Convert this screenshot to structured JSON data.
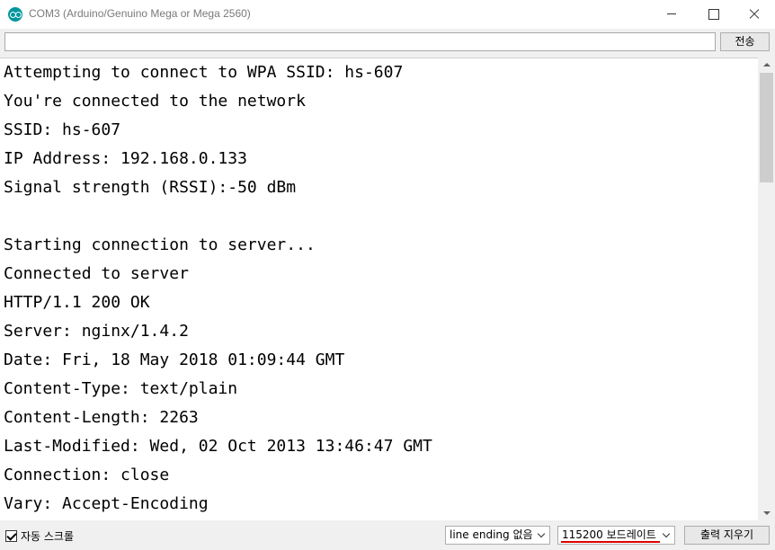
{
  "window": {
    "title": "COM3 (Arduino/Genuino Mega or Mega 2560)"
  },
  "send_bar": {
    "input_value": "",
    "send_label": "전송"
  },
  "output": {
    "lines": [
      "Attempting to connect to WPA SSID: hs-607",
      "You're connected to the network",
      "SSID: hs-607",
      "IP Address: 192.168.0.133",
      "Signal strength (RSSI):-50 dBm",
      "",
      "Starting connection to server...",
      "Connected to server",
      "HTTP/1.1 200 OK",
      "Server: nginx/1.4.2",
      "Date: Fri, 18 May 2018 01:09:44 GMT",
      "Content-Type: text/plain",
      "Content-Length: 2263",
      "Last-Modified: Wed, 02 Oct 2013 13:46:47 GMT",
      "Connection: close",
      "Vary: Accept-Encoding"
    ]
  },
  "footer": {
    "autoscroll_label": "자동 스크롤",
    "autoscroll_checked": true,
    "line_ending": "line ending 없음",
    "baud_rate": "115200 보드레이트",
    "clear_label": "출력 지우기"
  },
  "colors": {
    "app_icon": "#00979c",
    "baud_underline": "#e00000"
  }
}
